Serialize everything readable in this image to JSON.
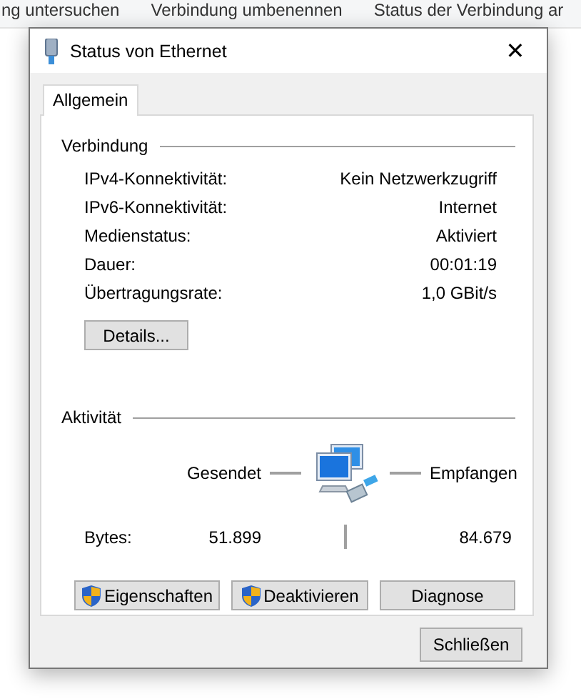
{
  "background_toolbar": {
    "items": [
      "ng untersuchen",
      "Verbindung umbenennen",
      "Status der Verbindung ar"
    ]
  },
  "window": {
    "title": "Status von Ethernet",
    "close": "✕"
  },
  "tabs": [
    {
      "label": "Allgemein",
      "selected": true
    }
  ],
  "connection": {
    "heading": "Verbindung",
    "rows": [
      {
        "label": "IPv4-Konnektivität:",
        "value": "Kein Netzwerkzugriff"
      },
      {
        "label": "IPv6-Konnektivität:",
        "value": "Internet"
      },
      {
        "label": "Medienstatus:",
        "value": "Aktiviert"
      },
      {
        "label": "Dauer:",
        "value": "00:01:19"
      },
      {
        "label": "Übertragungsrate:",
        "value": "1,0 GBit/s"
      }
    ],
    "details_button": "Details..."
  },
  "activity": {
    "heading": "Aktivität",
    "sent_label": "Gesendet",
    "received_label": "Empfangen",
    "bytes_label": "Bytes:",
    "sent": "51.899",
    "received": "84.679"
  },
  "buttons": [
    {
      "label": "Eigenschaften",
      "shield": true
    },
    {
      "label": "Deaktivieren",
      "shield": true
    },
    {
      "label": "Diagnose",
      "shield": false
    }
  ],
  "close_button": "Schließen"
}
